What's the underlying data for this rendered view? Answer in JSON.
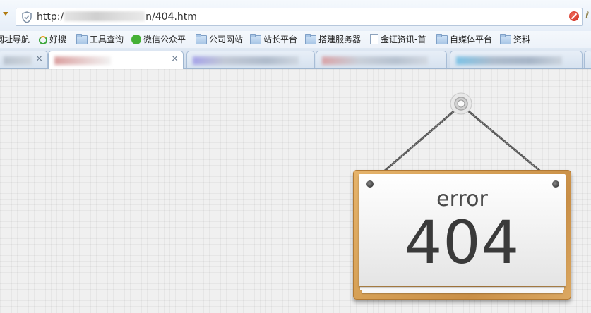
{
  "address_bar": {
    "url_prefix": "http:/",
    "url_suffix": "n/404.htm"
  },
  "bookmarks": [
    {
      "label": "网址导航",
      "icon": "none"
    },
    {
      "label": "好搜",
      "icon": "haosou-icon"
    },
    {
      "label": "工具查询",
      "icon": "folder-icon"
    },
    {
      "label": "微信公众平",
      "icon": "wechat-icon"
    },
    {
      "label": "公司网站",
      "icon": "folder-icon"
    },
    {
      "label": "站长平台",
      "icon": "folder-icon"
    },
    {
      "label": "搭建服务器",
      "icon": "folder-icon"
    },
    {
      "label": "金证资讯-首",
      "icon": "document-icon"
    },
    {
      "label": "自媒体平台",
      "icon": "folder-icon"
    },
    {
      "label": "资料",
      "icon": "folder-icon"
    }
  ],
  "tabs": {
    "close_glyph": "×"
  },
  "error_sign": {
    "word": "error",
    "code": "404"
  },
  "colors": {
    "wood": "#d59f55",
    "card": "#f2f2f2",
    "text": "#3a3a3a"
  }
}
